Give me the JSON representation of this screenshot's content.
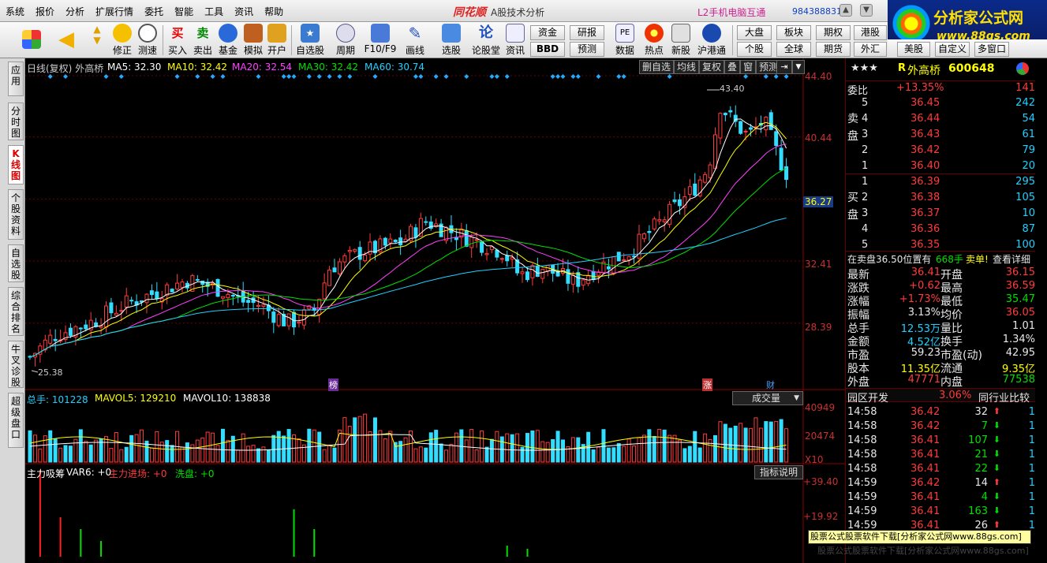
{
  "menubar": {
    "items": [
      "系统",
      "报价",
      "分析",
      "扩展行情",
      "委托",
      "智能",
      "工具",
      "资讯",
      "帮助"
    ],
    "brand": "同花顺",
    "subtitle": "A股技术分析",
    "l2": "L2手机电脑互通",
    "phone": "984388831"
  },
  "logo": {
    "title": "分析家公式网",
    "url": "www.88gs.com"
  },
  "toolbar": {
    "buttons": [
      "修正",
      "测速",
      "买入",
      "卖出",
      "基金",
      "模拟",
      "开户",
      "自选股",
      "周期",
      "F10/F9",
      "画线",
      "选股",
      "论股堂",
      "资讯",
      "数据",
      "热点",
      "新股",
      "沪港通"
    ],
    "funds": "资金",
    "bbd": "BBD",
    "research": "研报",
    "forecast": "预测",
    "market": "大盘",
    "sector": "板块",
    "individual": "个股",
    "global": "全球",
    "futures": "期权",
    "futures2": "期货",
    "hk": "港股",
    "fx": "外汇",
    "us": "美股",
    "custom": "自定义",
    "multiwin": "多窗口"
  },
  "sidebar": {
    "tabs": [
      "应用",
      "分时图",
      "K线图",
      "个股资料",
      "自选股",
      "综合排名",
      "牛叉诊股",
      "超级盘口"
    ]
  },
  "kchart": {
    "period_label": "日线(复权)",
    "stock_name": "外高桥",
    "ma5": "MA5: 32.30",
    "ma10": "MA10: 32.42",
    "ma20": "MA20: 32.54",
    "ma30": "MA30: 32.42",
    "ma60": "MA60: 30.74",
    "tools": [
      "删自选",
      "均线",
      "复权",
      "叠",
      "窗",
      "预测"
    ],
    "y_ticks": [
      "44.40",
      "40.44",
      "32.41",
      "28.39"
    ],
    "current_price": "36.27",
    "high_mark": "43.40",
    "low_mark": "25.38",
    "event_labels": [
      "榜",
      "涨",
      "财"
    ]
  },
  "volume": {
    "total": "总手: 101228",
    "mavol5": "MAVOL5: 129210",
    "mavol10": "MAVOL10: 138838",
    "selector": "成交量",
    "y_ticks": [
      "40949",
      "20474"
    ],
    "unit": "X10"
  },
  "indicator": {
    "name": "主力吸筹",
    "var6": "VAR6: +0",
    "inflow": "主力进场: +0",
    "wash": "洗盘: +0",
    "help": "指标说明",
    "y_ticks": [
      "+39.40",
      "+19.92"
    ]
  },
  "chart_data": {
    "type": "candlestick",
    "title": "外高桥 600648 日线(复权)",
    "ylim": [
      24.5,
      44.4
    ],
    "high": 43.4,
    "low": 25.38,
    "last": 36.27,
    "ma": [
      {
        "name": "MA5",
        "value": 32.3,
        "color": "#ffffff"
      },
      {
        "name": "MA10",
        "value": 32.42,
        "color": "#ffff00"
      },
      {
        "name": "MA20",
        "value": 32.54,
        "color": "#ff40ff"
      },
      {
        "name": "MA30",
        "value": 32.42,
        "color": "#00e000"
      },
      {
        "name": "MA60",
        "value": 30.74,
        "color": "#22d0ff"
      }
    ]
  },
  "quote": {
    "stars": "★★★",
    "r": "R",
    "name": "外高桥",
    "code": "600648",
    "weibi_label": "委比",
    "weibi": "+13.35%",
    "weicha": "141",
    "sell_label": "卖盘",
    "buy_label": "买盘",
    "sell": [
      {
        "lvl": "5",
        "price": "36.45",
        "vol": "242"
      },
      {
        "lvl": "4",
        "price": "36.44",
        "vol": "54"
      },
      {
        "lvl": "3",
        "price": "36.43",
        "vol": "61"
      },
      {
        "lvl": "2",
        "price": "36.42",
        "vol": "79"
      },
      {
        "lvl": "1",
        "price": "36.40",
        "vol": "20"
      }
    ],
    "buy": [
      {
        "lvl": "1",
        "price": "36.39",
        "vol": "295"
      },
      {
        "lvl": "2",
        "price": "36.38",
        "vol": "105"
      },
      {
        "lvl": "3",
        "price": "36.37",
        "vol": "10"
      },
      {
        "lvl": "4",
        "price": "36.36",
        "vol": "87"
      },
      {
        "lvl": "5",
        "price": "36.35",
        "vol": "100"
      }
    ],
    "note": "在卖盘36.50位置有",
    "note_vol": "668手",
    "note_tag": "卖单!",
    "note_link": "查看详细",
    "stats": [
      [
        "最新",
        "36.41",
        "开盘",
        "36.15"
      ],
      [
        "涨跌",
        "+0.62",
        "最高",
        "36.59"
      ],
      [
        "涨幅",
        "+1.73%",
        "最低",
        "35.47"
      ],
      [
        "振幅",
        "3.13%",
        "均价",
        "36.05"
      ],
      [
        "总手",
        "12.53万",
        "量比",
        "1.01"
      ],
      [
        "金额",
        "4.52亿",
        "换手",
        "1.34%"
      ],
      [
        "市盈",
        "59.23",
        "市盈(动)",
        "42.95"
      ],
      [
        "股本",
        "11.35亿",
        "流通",
        "9.35亿"
      ],
      [
        "外盘",
        "47771",
        "内盘",
        "77538"
      ]
    ],
    "sector_name": "园区开发",
    "sector_pct": "3.06%",
    "peer": "同行业比较",
    "ticks": [
      {
        "t": "14:58",
        "p": "36.42",
        "v": "32",
        "d": "up",
        "n": "1"
      },
      {
        "t": "14:58",
        "p": "36.42",
        "v": "7",
        "d": "dn",
        "n": "1"
      },
      {
        "t": "14:58",
        "p": "36.41",
        "v": "107",
        "d": "dn",
        "n": "1"
      },
      {
        "t": "14:58",
        "p": "36.41",
        "v": "21",
        "d": "dn",
        "n": "1"
      },
      {
        "t": "14:58",
        "p": "36.41",
        "v": "22",
        "d": "dn",
        "n": "1"
      },
      {
        "t": "14:59",
        "p": "36.42",
        "v": "14",
        "d": "up",
        "n": "1"
      },
      {
        "t": "14:59",
        "p": "36.41",
        "v": "4",
        "d": "dn",
        "n": "1"
      },
      {
        "t": "14:59",
        "p": "36.41",
        "v": "163",
        "d": "dn",
        "n": "1"
      },
      {
        "t": "14:59",
        "p": "36.41",
        "v": "26",
        "d": "up",
        "n": "1"
      }
    ]
  },
  "watermark": "股票公式股票软件下载[分析家公式网www.88gs.com]",
  "watermark2": "股票公式股票软件下载[分析家公式网www.88gs.com]"
}
